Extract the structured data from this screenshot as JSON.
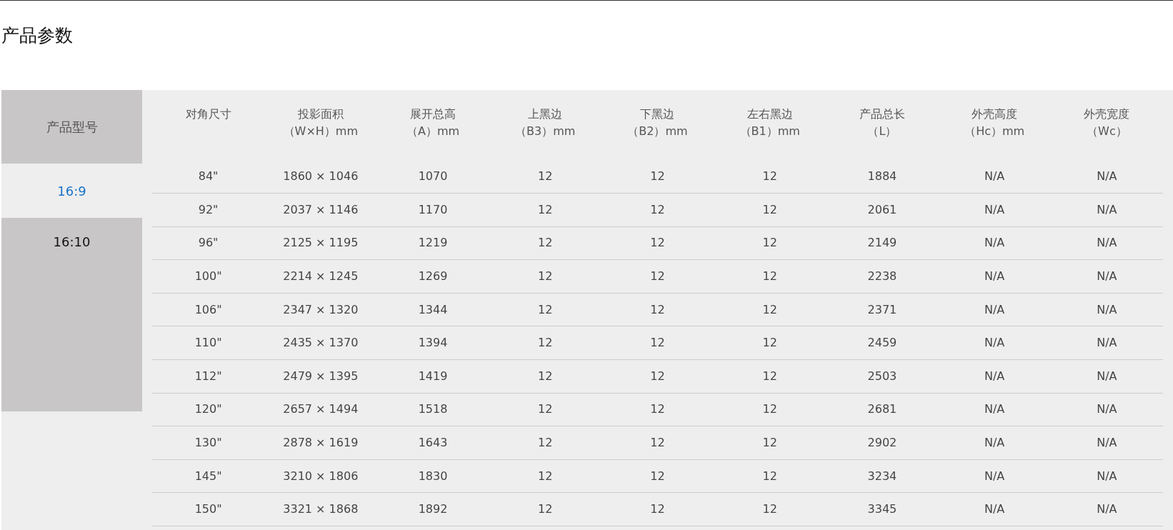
{
  "title": "产品参数",
  "corner_header": "产品型号",
  "ratio_tabs": [
    {
      "label": "16:9",
      "selected": true
    },
    {
      "label": "16:10",
      "selected": false
    }
  ],
  "table": {
    "columns": [
      "对角尺寸",
      "投影面积（W×H）mm",
      "展开总高（A）mm",
      "上黑边（B3）mm",
      "下黑边（B2）mm",
      "左右黑边（B1）mm",
      "产品总长（L）",
      "外壳高度（Hc）mm",
      "外壳宽度（Wc）"
    ],
    "rows": [
      [
        "84\"",
        "1860 × 1046",
        "1070",
        "12",
        "12",
        "12",
        "1884",
        "N/A",
        "N/A"
      ],
      [
        "92\"",
        "2037 × 1146",
        "1170",
        "12",
        "12",
        "12",
        "2061",
        "N/A",
        "N/A"
      ],
      [
        "96\"",
        "2125 × 1195",
        "1219",
        "12",
        "12",
        "12",
        "2149",
        "N/A",
        "N/A"
      ],
      [
        "100\"",
        "2214 × 1245",
        "1269",
        "12",
        "12",
        "12",
        "2238",
        "N/A",
        "N/A"
      ],
      [
        "106\"",
        "2347 × 1320",
        "1344",
        "12",
        "12",
        "12",
        "2371",
        "N/A",
        "N/A"
      ],
      [
        "110\"",
        "2435 × 1370",
        "1394",
        "12",
        "12",
        "12",
        "2459",
        "N/A",
        "N/A"
      ],
      [
        "112\"",
        "2479 × 1395",
        "1419",
        "12",
        "12",
        "12",
        "2503",
        "N/A",
        "N/A"
      ],
      [
        "120\"",
        "2657 × 1494",
        "1518",
        "12",
        "12",
        "12",
        "2681",
        "N/A",
        "N/A"
      ],
      [
        "130\"",
        "2878 × 1619",
        "1643",
        "12",
        "12",
        "12",
        "2902",
        "N/A",
        "N/A"
      ],
      [
        "145\"",
        "3210 × 1806",
        "1830",
        "12",
        "12",
        "12",
        "3234",
        "N/A",
        "N/A"
      ],
      [
        "150\"",
        "3321 × 1868",
        "1892",
        "12",
        "12",
        "12",
        "3345",
        "N/A",
        "N/A"
      ]
    ]
  }
}
